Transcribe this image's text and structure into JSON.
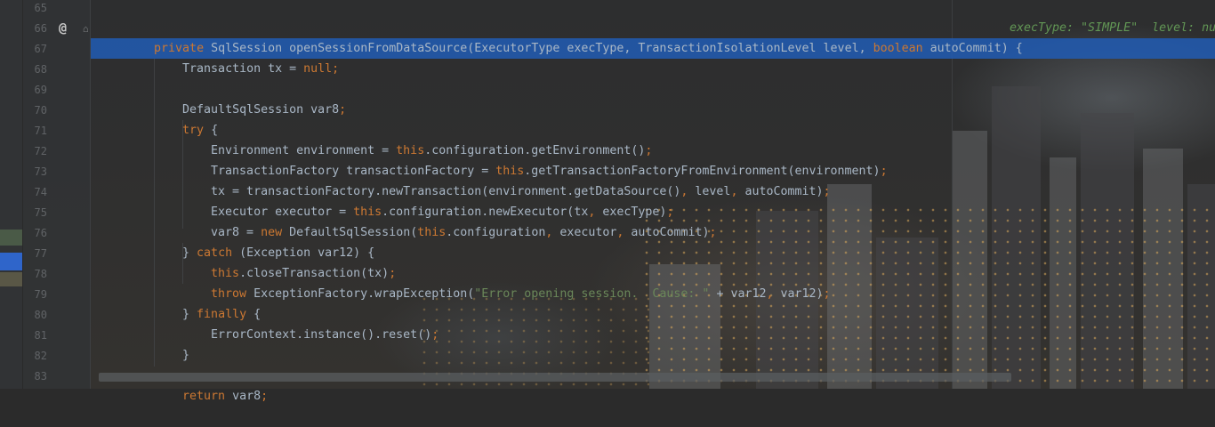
{
  "gutter": {
    "line_numbers": [
      "65",
      "66",
      "67",
      "68",
      "69",
      "70",
      "71",
      "72",
      "73",
      "74",
      "75",
      "76",
      "77",
      "78",
      "79",
      "80",
      "81",
      "82",
      "83"
    ],
    "override_marker": "@",
    "bookmark_marker": "⌂"
  },
  "code": {
    "l66": {
      "indent": "    ",
      "kw_private": "private",
      "sig": " SqlSession openSessionFromDataSource(ExecutorType execType, TransactionIsolationLevel level, ",
      "kw_boolean": "boolean",
      "sig_end": " autoCommit) {",
      "hint": "execType: \"SIMPLE\"  level: nu"
    },
    "l67": {
      "pre": "Transaction tx = ",
      "kw": "null",
      "semi": ";"
    },
    "l69": {
      "text": "DefaultSqlSession var8",
      "semi": ";"
    },
    "l70": {
      "kw": "try",
      "rest": " {"
    },
    "l71": {
      "pre": "Environment environment = ",
      "kw": "this",
      "rest": ".configuration.getEnvironment()",
      "semi": ";"
    },
    "l72": {
      "pre": "TransactionFactory transactionFactory = ",
      "kw": "this",
      "rest": ".getTransactionFactoryFromEnvironment(environment)",
      "semi": ";"
    },
    "l73": {
      "pre": "tx = transactionFactory.newTransaction(environment.getDataSource()",
      "c1": ",",
      "mid": " level",
      "c2": ",",
      "end": " autoCommit)",
      "semi": ";"
    },
    "l74": {
      "pre": "Executor executor = ",
      "kw": "this",
      "rest": ".configuration.newExecutor(tx",
      "c1": ",",
      "end": " execType)",
      "semi": ";"
    },
    "l75": {
      "pre": "var8 = ",
      "kw_new": "new",
      "mid": " DefaultSqlSession(",
      "kw_this": "this",
      "rest": ".configuration",
      "c1": ",",
      "mid2": " executor",
      "c2": ",",
      "end": " autoCommit)",
      "semi": ";"
    },
    "l76": {
      "pre": "} ",
      "kw": "catch",
      "rest": " (Exception var12) {"
    },
    "l77": {
      "kw": "this",
      "rest": ".closeTransaction(tx)",
      "semi": ";"
    },
    "l78": {
      "kw": "throw",
      "pre": " ExceptionFactory.wrapException(",
      "str": "\"Error opening session.  Cause: \"",
      "mid": " + var12",
      "c1": ",",
      "end": " var12)",
      "semi": ";"
    },
    "l79": {
      "pre": "} ",
      "kw": "finally",
      "rest": " {"
    },
    "l80": {
      "text": "ErrorContext.instance().reset()",
      "semi": ";"
    },
    "l81": {
      "text": "}"
    },
    "l83": {
      "kw": "return",
      "rest": " var8",
      "semi": ";"
    }
  },
  "colors": {
    "keyword": "#cc7832",
    "string": "#6a8759",
    "default_text": "#a9b7c6",
    "line_number": "#606366",
    "current_line": "#2f65ca",
    "inline_hint": "#629755"
  }
}
